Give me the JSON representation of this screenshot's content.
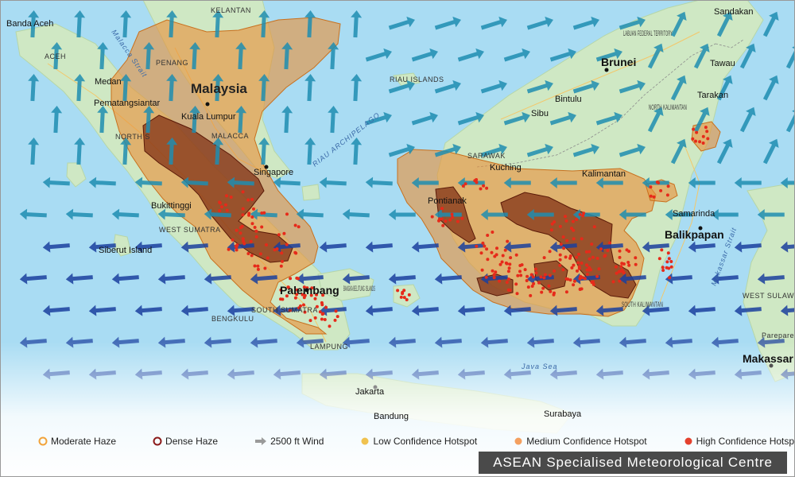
{
  "map": {
    "places": [
      {
        "id": "banda-aceh",
        "text": "Banda Aceh"
      },
      {
        "id": "aceh",
        "text": "ACEH"
      },
      {
        "id": "medan",
        "text": "Medan"
      },
      {
        "id": "pematangsiantar",
        "text": "Pematangsiantar"
      },
      {
        "id": "north-sumatra",
        "text": "NORTH S"
      },
      {
        "id": "penang",
        "text": "PENANG"
      },
      {
        "id": "kelantan",
        "text": "KELANTAN"
      },
      {
        "id": "malaysia",
        "text": "Malaysia"
      },
      {
        "id": "kuala-lumpur",
        "text": "Kuala Lumpur"
      },
      {
        "id": "malacca",
        "text": "MALACCA"
      },
      {
        "id": "singapore",
        "text": "Singapore"
      },
      {
        "id": "riau-islands",
        "text": "RIAU ISLANDS"
      },
      {
        "id": "riau-archipelago",
        "text": "RIAU ARCHIPELAGO"
      },
      {
        "id": "bukittinggi",
        "text": "Bukittinggi"
      },
      {
        "id": "west-sumatra",
        "text": "WEST SUMATRA"
      },
      {
        "id": "siberut",
        "text": "Siberut Island"
      },
      {
        "id": "palembang",
        "text": "Palembang"
      },
      {
        "id": "south-sumatra",
        "text": "SOUTH SUMATRA"
      },
      {
        "id": "bengkulu",
        "text": "BENGKULU"
      },
      {
        "id": "lampung",
        "text": "LAMPUNG"
      },
      {
        "id": "bangka-belitung",
        "text": "BANGKA BELITUNG ISLANDS"
      },
      {
        "id": "jakarta",
        "text": "Jakarta"
      },
      {
        "id": "bandung",
        "text": "Bandung"
      },
      {
        "id": "java-sea",
        "text": "Java Sea"
      },
      {
        "id": "surabaya",
        "text": "Surabaya"
      },
      {
        "id": "sarawak",
        "text": "SARAWAK"
      },
      {
        "id": "kuching",
        "text": "Kuching"
      },
      {
        "id": "pontianak",
        "text": "Pontianak"
      },
      {
        "id": "brunei",
        "text": "Brunei"
      },
      {
        "id": "labuan",
        "text": "LABUAN FEDERAL TERRITORY"
      },
      {
        "id": "sandakan",
        "text": "Sandakan"
      },
      {
        "id": "tawau",
        "text": "Tawau"
      },
      {
        "id": "bintulu",
        "text": "Bintulu"
      },
      {
        "id": "sibu",
        "text": "Sibu"
      },
      {
        "id": "tarakan",
        "text": "Tarakan"
      },
      {
        "id": "north-kalimantan",
        "text": "NORTH KALIMANTAN"
      },
      {
        "id": "kalimantan",
        "text": "Kalimantan"
      },
      {
        "id": "samarinda",
        "text": "Samarinda"
      },
      {
        "id": "balikpapan",
        "text": "Balikpapan"
      },
      {
        "id": "south-kalimantan",
        "text": "SOUTH KALIMANTAN"
      },
      {
        "id": "makassar-strait",
        "text": "Makassar Strait"
      },
      {
        "id": "west-sulawesi",
        "text": "WEST SULAWESI"
      },
      {
        "id": "makassar",
        "text": "Makassar"
      },
      {
        "id": "parepare",
        "text": "Parepare"
      },
      {
        "id": "malacca-strait",
        "text": "Malacca Strait"
      }
    ]
  },
  "legend": [
    {
      "id": "moderate-haze",
      "label": "Moderate Haze",
      "color": "#f2a33a",
      "shape": "ring"
    },
    {
      "id": "dense-haze",
      "label": "Dense Haze",
      "color": "#8b1a1a",
      "shape": "ring"
    },
    {
      "id": "wind",
      "label": "2500 ft Wind",
      "color": "#9a9a9a",
      "shape": "arrow"
    },
    {
      "id": "low-hotspot",
      "label": "Low Confidence Hotspot",
      "color": "#f0c24f",
      "shape": "dot"
    },
    {
      "id": "medium-hotspot",
      "label": "Medium Confidence Hotspot",
      "color": "#f4a060",
      "shape": "dot"
    },
    {
      "id": "high-hotspot",
      "label": "High Confidence Hotspot",
      "color": "#e4412e",
      "shape": "dot"
    }
  ],
  "credit": "ASEAN Specialised Meteorological Centre",
  "colors": {
    "sea": "#a9dcf3",
    "land": "#cfe8c4",
    "haze_moderate": "#e8913a",
    "haze_dense": "#7a2a10",
    "hotspot": "#e62a1a",
    "wind_dark": "#1b3f9e",
    "wind_light": "#1f8db0"
  }
}
